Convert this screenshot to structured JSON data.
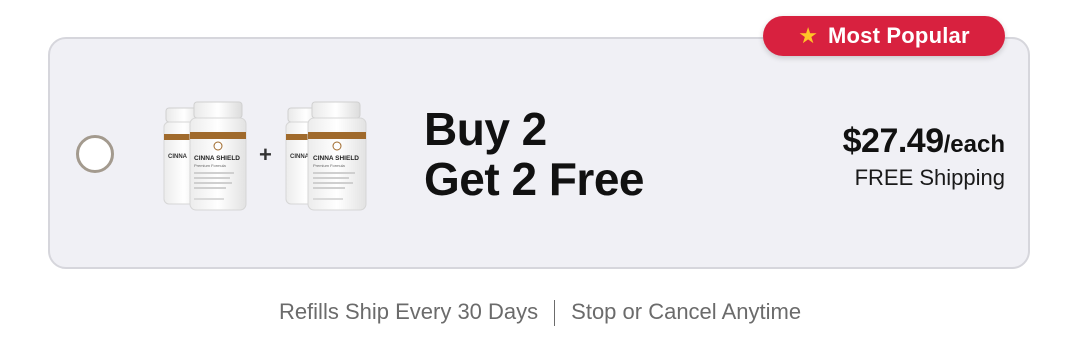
{
  "badge": {
    "icon": "star-icon",
    "label": "Most Popular",
    "color": "#d8213f",
    "star_color": "#ffc627"
  },
  "offer": {
    "selected": false,
    "headline_line1": "Buy 2",
    "headline_line2": "Get 2 Free",
    "price": "$27.49",
    "price_unit": "/each",
    "shipping": "FREE Shipping",
    "product_label": "CINNA SHIELD",
    "product_sublabel": "Premium Formula",
    "plus_sign": "+"
  },
  "footer": {
    "left": "Refills Ship Every 30 Days",
    "right": "Stop or Cancel Anytime"
  }
}
